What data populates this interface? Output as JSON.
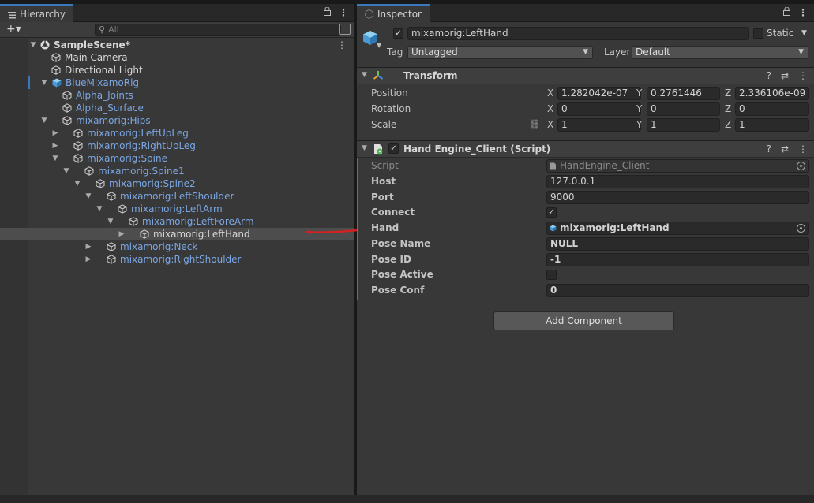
{
  "hierarchy": {
    "tab_label": "Hierarchy",
    "add_label": "+▾",
    "search_placeholder": "All",
    "scene": "SampleScene*",
    "rows": [
      {
        "label": "Main Camera",
        "depth": 2
      },
      {
        "label": "Directional Light",
        "depth": 2
      },
      {
        "label": "BlueMixamoRig",
        "depth": 2
      },
      {
        "label": "Alpha_Joints",
        "depth": 3
      },
      {
        "label": "Alpha_Surface",
        "depth": 3
      },
      {
        "label": "mixamorig:Hips",
        "depth": 3
      },
      {
        "label": "mixamorig:LeftUpLeg",
        "depth": 4
      },
      {
        "label": "mixamorig:RightUpLeg",
        "depth": 4
      },
      {
        "label": "mixamorig:Spine",
        "depth": 4
      },
      {
        "label": "mixamorig:Spine1",
        "depth": 5
      },
      {
        "label": "mixamorig:Spine2",
        "depth": 6
      },
      {
        "label": "mixamorig:LeftShoulder",
        "depth": 7
      },
      {
        "label": "mixamorig:LeftArm",
        "depth": 8
      },
      {
        "label": "mixamorig:LeftForeArm",
        "depth": 9
      },
      {
        "label": "mixamorig:LeftHand",
        "depth": 10
      },
      {
        "label": "mixamorig:Neck",
        "depth": 7
      },
      {
        "label": "mixamorig:RightShoulder",
        "depth": 7
      }
    ]
  },
  "inspector": {
    "tab_label": "Inspector",
    "object_name": "mixamorig:LeftHand",
    "static_label": "Static",
    "tag_label": "Tag",
    "tag_value": "Untagged",
    "layer_label": "Layer",
    "layer_value": "Default",
    "transform": {
      "title": "Transform",
      "position_label": "Position",
      "rotation_label": "Rotation",
      "scale_label": "Scale",
      "axis_x": "X",
      "axis_y": "Y",
      "axis_z": "Z",
      "position": {
        "x": "1.282042e-07",
        "y": "0.2761446",
        "z": "2.336106e-09"
      },
      "rotation": {
        "x": "0",
        "y": "0",
        "z": "0"
      },
      "scale": {
        "x": "1",
        "y": "1",
        "z": "1"
      }
    },
    "script_component": {
      "title": "Hand Engine_Client (Script)",
      "script_label": "Script",
      "script_value": "HandEngine_Client",
      "host_label": "Host",
      "host_value": "127.0.0.1",
      "port_label": "Port",
      "port_value": "9000",
      "connect_label": "Connect",
      "connect_checked": true,
      "hand_label": "Hand",
      "hand_value": "mixamorig:LeftHand",
      "pose_name_label": "Pose Name",
      "pose_name_value": "NULL",
      "pose_id_label": "Pose ID",
      "pose_id_value": "-1",
      "pose_active_label": "Pose Active",
      "pose_active_checked": false,
      "pose_conf_label": "Pose Conf",
      "pose_conf_value": "0"
    },
    "add_component_label": "Add Component"
  },
  "colors": {
    "accent_blue": "#3a79bb",
    "prefab_text": "#7ba7e4",
    "annotation_arrow": "#d42020"
  }
}
